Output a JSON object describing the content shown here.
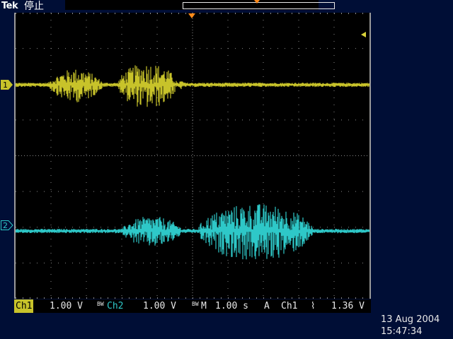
{
  "header": {
    "brand": "Tek",
    "acquisition_status": "停止"
  },
  "colors": {
    "ch1": "#c8c32a",
    "ch2": "#2ec8c8",
    "trigger_marker": "#ff8a1a",
    "graticule": "#8a8a8a",
    "background": "#000e36"
  },
  "channels": {
    "ch1": {
      "marker": "1",
      "label": "Ch1",
      "scale": "1.00 V"
    },
    "ch2": {
      "bandwidth_icon": "BW",
      "label": "Ch2",
      "scale": "1.00 V"
    }
  },
  "timebase": {
    "bandwidth_icon": "BW",
    "label": "M",
    "scale": "1.00 s"
  },
  "trigger": {
    "mode": "A",
    "source": "Ch1",
    "slope_icon": "falling-edge-icon",
    "slope_glyph": "⌇",
    "level": "1.36 V"
  },
  "ch2_marker": "2",
  "timestamp": {
    "date": "13 Aug 2004",
    "time": "15:47:34"
  }
}
